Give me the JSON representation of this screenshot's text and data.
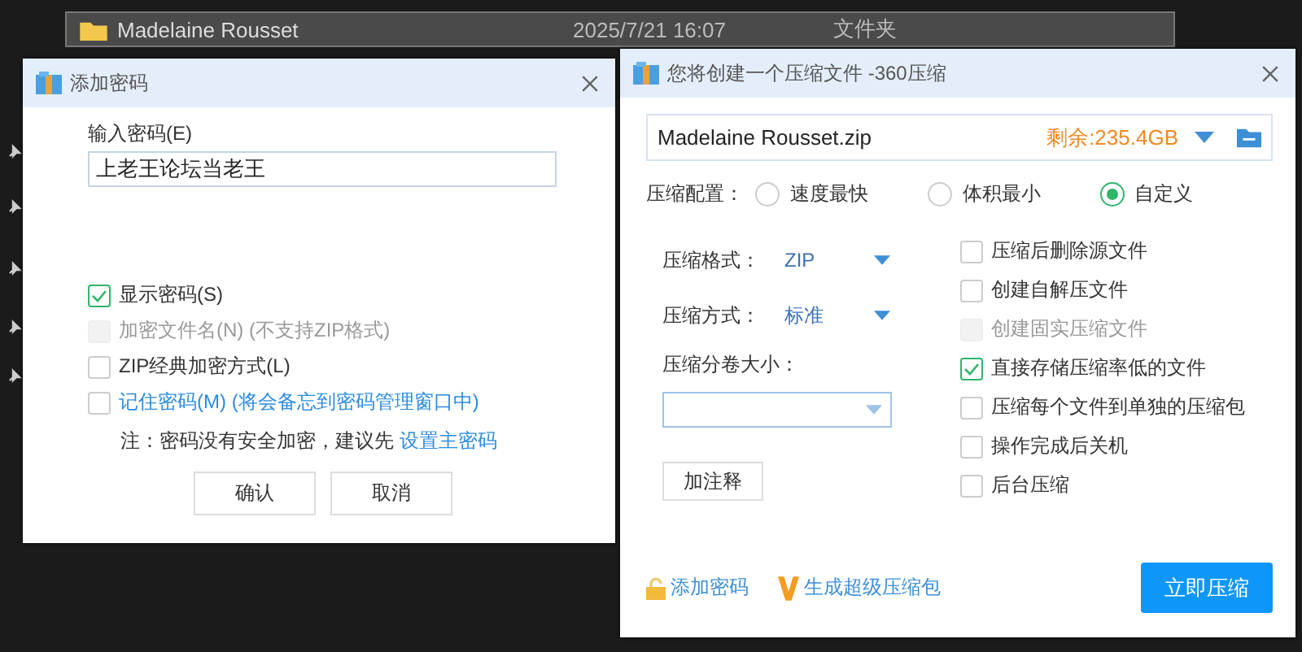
{
  "file_row": {
    "name": "Madelaine Rousset",
    "modified": "2025/7/21 16:07",
    "type": "文件夹"
  },
  "password_dialog": {
    "title": "添加密码",
    "password_label": "输入密码(E)",
    "password_value": "上老王论坛当老王",
    "options": [
      {
        "label": "显示密码(S)",
        "checked": true,
        "disabled": false,
        "kind": "plain"
      },
      {
        "label": "加密文件名(N) (不支持ZIP格式)",
        "checked": false,
        "disabled": true,
        "kind": "plain"
      },
      {
        "label": "ZIP经典加密方式(L)",
        "checked": false,
        "disabled": false,
        "kind": "plain"
      },
      {
        "label": "记住密码(M) (将会备忘到密码管理窗口中)",
        "checked": false,
        "disabled": false,
        "kind": "link"
      }
    ],
    "note": "注：密码没有安全加密，建议先",
    "note_link": "设置主密码",
    "buttons": [
      "确认",
      "取消"
    ]
  },
  "compress_dialog": {
    "title": "您将创建一个压缩文件 -360压缩",
    "file_name": "Madelaine Rousset.zip",
    "free_space": "剩余:235.4GB",
    "profile_label": "压缩配置：",
    "profiles": [
      {
        "label": "速度最快",
        "selected": false
      },
      {
        "label": "体积最小",
        "selected": false
      },
      {
        "label": "自定义",
        "selected": true
      }
    ],
    "format_label": "压缩格式：",
    "format_value": "ZIP",
    "method_label": "压缩方式：",
    "method_value": "标准",
    "split_label": "压缩分卷大小：",
    "comment_button": "加注释",
    "options": [
      {
        "label": "压缩后删除源文件",
        "checked": false,
        "disabled": false
      },
      {
        "label": "创建自解压文件",
        "checked": false,
        "disabled": false
      },
      {
        "label": "创建固实压缩文件",
        "checked": false,
        "disabled": true
      },
      {
        "label": "直接存储压缩率低的文件",
        "checked": true,
        "disabled": false
      },
      {
        "label": "压缩每个文件到单独的压缩包",
        "checked": false,
        "disabled": false
      },
      {
        "label": "操作完成后关机",
        "checked": false,
        "disabled": false
      },
      {
        "label": "后台压缩",
        "checked": false,
        "disabled": false
      }
    ],
    "add_password": "添加密码",
    "super_package": "生成超级压缩包",
    "start_button": "立即压缩"
  }
}
